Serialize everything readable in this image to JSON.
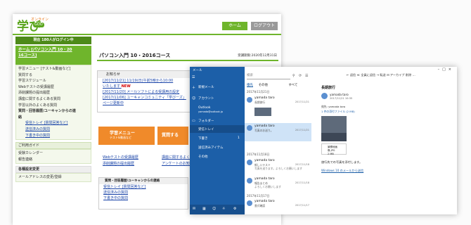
{
  "site": {
    "logo_text": "学び",
    "logo_sub": "オンライン",
    "logo_badge": "GOO",
    "home_button": "ホーム",
    "logout_button": "ログアウト",
    "login_count": "現在 180人がログイン中",
    "home_box_line1": "ホーム [パソコン入門 10・20",
    "home_box_line2": "16コース]",
    "menu": [
      {
        "label": "学習メニュー [テスト&動画など]"
      },
      {
        "label": "質問する"
      },
      {
        "label": "学習スケジュール"
      },
      {
        "label": "Webテストの受講履歴"
      },
      {
        "label": "添削課題の提出履歴"
      },
      {
        "label": "講座に関するよくある質問"
      },
      {
        "label": "学習以外のよくある質問"
      },
      {
        "label": "質問・回答履歴/ユーキャンからの連"
      },
      {
        "label": "絡"
      }
    ],
    "submenu": [
      {
        "label": "受信トレイ [質問回答など]"
      },
      {
        "label": "送信済みの質問"
      },
      {
        "label": "下書き中の質問"
      }
    ],
    "guide_title": "ご利用ガイド",
    "guide_items": [
      {
        "label": "受験カレンダー"
      },
      {
        "label": "報告連絡"
      }
    ],
    "settings_title": "各種設定変更",
    "settings_items": [
      {
        "label": "メールアドレスの変更/登録"
      }
    ],
    "course_title": "パソコン入門 10・2016コース",
    "period": "受講期限:2020年12月31日",
    "notice_title": "お知らせ",
    "notices": [
      {
        "text": "[2017/11/21] 11/19(日)午前5時から10:00",
        "new": ""
      },
      {
        "text": "いたします",
        "new": "NEW"
      },
      {
        "text": "[2017/11/20] メールソフトによる受講用の設定",
        "new": ""
      },
      {
        "text": "[2017/11/06] ユーキャンコミュニティ「学びーズ」",
        "new": ""
      },
      {
        "text": "ページ更新中",
        "new": ""
      }
    ],
    "btn_test_title": "学習メニュー",
    "btn_test_sub": "テスト&動画など",
    "btn_question": "質問する",
    "links": [
      {
        "label": "Webテストの受講履歴"
      },
      {
        "label": "添削課題の提出履歴"
      },
      {
        "label": "講座に関するよくあ"
      },
      {
        "label": "アンケートのお知ら"
      }
    ],
    "forum_title": "質問・回答履歴/ユーキャンからの連絡",
    "forum_items": [
      {
        "label": "受信トレイ [質問回答など]"
      },
      {
        "label": "送信済みの質問"
      },
      {
        "label": "下書き中の質問"
      }
    ]
  },
  "mail": {
    "app_name": "メール",
    "nav_items": [
      {
        "icon": "menu-icon",
        "label": ""
      },
      {
        "icon": "compose-icon",
        "label": "新規メール"
      },
      {
        "icon": "person-icon",
        "label": "アカウント"
      },
      {
        "icon": "",
        "label": "Outlook"
      },
      {
        "icon": "",
        "label": "yamada@outlook.jp"
      },
      {
        "icon": "folder-icon",
        "label": "フォルダー"
      },
      {
        "icon": "",
        "label": "受信トレイ"
      },
      {
        "icon": "",
        "label": "下書き"
      },
      {
        "icon": "",
        "label": "送信済みアイテム"
      },
      {
        "icon": "",
        "label": "その他"
      }
    ],
    "draft_count": "1",
    "search_placeholder": "検索",
    "tab_focused": "優先",
    "tab_other": "その他",
    "filter_label": "すべて",
    "groups": [
      {
        "label": "2017年11月21日"
      },
      {
        "label": "2017年11月18日"
      },
      {
        "label": "2017年11月17日"
      }
    ],
    "messages": [
      {
        "from": "yamada taro",
        "subject": "長期旅行",
        "preview": "",
        "date": "2017/11/21",
        "thumb": "yes"
      },
      {
        "from": "yamada taro",
        "subject": "写真のお送り。",
        "preview": "",
        "date": "2017/11/21",
        "thumb": ""
      },
      {
        "from": "yamada taro",
        "subject": "新しいテスト",
        "preview": "写真を送ります。よろしくお願いします",
        "date": "2017/11/18",
        "thumb": ""
      },
      {
        "from": "yamada taro",
        "subject": "報告まとめ",
        "preview": "よろしくお願いします",
        "date": "2017/11/18",
        "thumb": ""
      },
      {
        "from": "yamada taro",
        "subject": "書式確認",
        "preview": "",
        "date": "2017/11/17",
        "thumb": ""
      },
      {
        "from": "yamada taro",
        "subject": "テスト",
        "preview": "",
        "date": "2017/11/17",
        "thumb": ""
      }
    ],
    "reading": {
      "toolbar": "← 返信  ≪ 全員に返信  → 転送  ⊟ アーカイブ  削除 …",
      "subject": "長期旅行",
      "from": "yamada taro",
      "date": "2017/11/21 10:35",
      "to": "宛先: yamada taro",
      "attach": "1 件の添付ファイル (2 MB)",
      "file_name": "景勝地画像.JPG",
      "file_size": "2 MB",
      "body1": "旅行先での写真を添付します。",
      "body2": "Windows 10 のメールから送信"
    }
  }
}
